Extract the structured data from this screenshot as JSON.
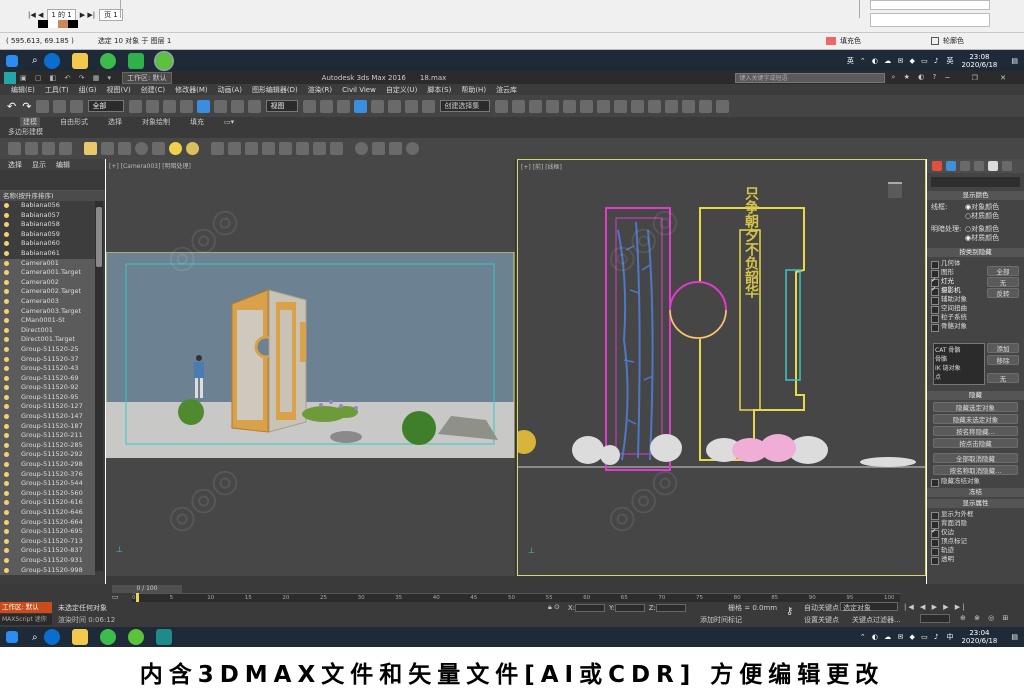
{
  "ai": {
    "layer_page": "1 的 1",
    "page_label": "页 1",
    "coords": "( 595.613, 69.185 )",
    "selection": "选定 10 对象 于 图层 1",
    "fill_label": "填充色",
    "stroke_label": "轮廓色"
  },
  "taskbar_top": {
    "ime": "英",
    "ime2": "英",
    "time": "23:08",
    "date": "2020/6/18"
  },
  "max": {
    "workspace": "工作区: 默认",
    "app_title": "Autodesk 3ds Max 2016",
    "file": "18.max",
    "search_placeholder": "键入关键字或短语",
    "menu": [
      "编辑(E)",
      "工具(T)",
      "组(G)",
      "视图(V)",
      "创建(C)",
      "修改器(M)",
      "动画(A)",
      "图形编辑器(D)",
      "渲染(R)",
      "Civil View",
      "自定义(U)",
      "脚本(S)",
      "帮助(H)",
      "渲云库"
    ],
    "filter": "全部",
    "view_dd": "视图",
    "sel_set": "创建选择集",
    "ribbon_tabs": [
      "建模",
      "自由形式",
      "选择",
      "对象绘制",
      "填充"
    ],
    "ribbon_sub": "多边形建模",
    "scene_tabs": [
      "选择",
      "显示",
      "编辑"
    ],
    "scene_header": "名称(按升序排序)",
    "scene_items": [
      "Babiana056",
      "Babiana057",
      "Babiana058",
      "Babiana059",
      "Babiana060",
      "Babiana061",
      "Camera001",
      "Camera001.Target",
      "Camera002",
      "Camera002.Target",
      "Camera003",
      "Camera003.Target",
      "CMan0001-St",
      "Direct001",
      "Direct001.Target",
      "Group-511520-25",
      "Group-511520-37",
      "Group-511520-43",
      "Group-511520-69",
      "Group-511520-92",
      "Group-511520-95",
      "Group-511520-127",
      "Group-511520-147",
      "Group-511520-187",
      "Group-511520-211",
      "Group-511520-285",
      "Group-511520-292",
      "Group-511520-298",
      "Group-511520-376",
      "Group-511520-544",
      "Group-511520-560",
      "Group-511520-616",
      "Group-511520-646",
      "Group-511520-664",
      "Group-511520-695",
      "Group-511520-713",
      "Group-511520-837",
      "Group-511520-931",
      "Group-511520-998"
    ],
    "vp_left": "[+] [Camera003] [明暗处理]",
    "vp_right": "[+] [前] [线框]",
    "calligraphy": "只争朝夕不负韶华",
    "cmd": {
      "display_color": "显示颜色",
      "wireframe": "线框:",
      "shaded": "明暗处理:",
      "obj_color": "对象颜色",
      "mat_color": "材质颜色",
      "hide_by_cat": "按类别隐藏",
      "cats": [
        "几何体",
        "图形",
        "灯光",
        "摄影机",
        "辅助对象",
        "空间扭曲",
        "粒子系统",
        "骨骼对象"
      ],
      "cats_checked": [
        false,
        false,
        true,
        true,
        false,
        false,
        false,
        false
      ],
      "all": "全部",
      "none": "无",
      "invert": "反转",
      "list_items": [
        "CAT 骨骼",
        "骨骼",
        "IK 链对象",
        "点"
      ],
      "add": "添加",
      "remove": "移除",
      "none2": "无",
      "hide": "隐藏",
      "hide_buttons": [
        "隐藏选定对象",
        "隐藏未选定对象",
        "按名称隐藏...",
        "按点击隐藏",
        "全部取消隐藏",
        "按名称取消隐藏...",
        "隐藏冻结对象"
      ],
      "freeze": "冻结",
      "disp_props": "显示属性",
      "props": [
        "显示为外框",
        "背面消隐",
        "仅边",
        "顶点标记",
        "轨迹",
        "透明"
      ],
      "props_checked": [
        false,
        false,
        true,
        false,
        false,
        false
      ]
    },
    "timeline": "0 / 100",
    "ticks": [
      "0",
      "5",
      "10",
      "15",
      "20",
      "25",
      "30",
      "35",
      "40",
      "45",
      "50",
      "55",
      "60",
      "65",
      "70",
      "75",
      "80",
      "85",
      "90",
      "95",
      "100"
    ],
    "workspace2": "工作区: 默认",
    "none_sel": "未选定任何对象",
    "render_time": "渲染时间 0:06:12",
    "grid": "栅格 = 0.0mm",
    "auto_key": "自动关键点",
    "sel_obj": "选定对象",
    "set_key": "设置关键点",
    "key_filter": "关键点过滤器...",
    "add_time_tag": "添加时间标记",
    "maxscript": "MAXScript 迷你"
  },
  "taskbar_bottom": {
    "ime": "中",
    "time": "23:04",
    "date": "2020/6/18"
  },
  "banner": "内含3DMAX文件和矢量文件[AI或CDR] 方便编辑更改",
  "colors": {
    "pink": "#e03ad0",
    "yellow": "#e8d84a",
    "cyan": "#39c7c7",
    "orange": "#e0a548"
  }
}
